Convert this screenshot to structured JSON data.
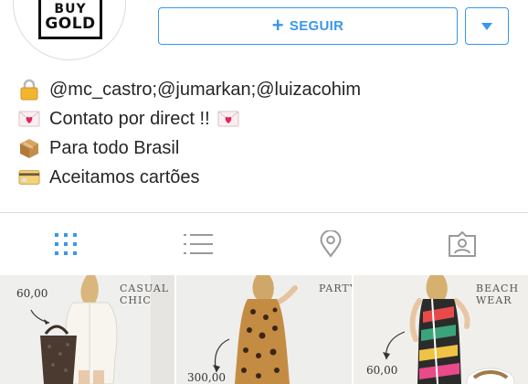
{
  "profile": {
    "logo_line1": "BUY",
    "logo_line2": "GOLD"
  },
  "actions": {
    "follow_label": "SEGUIR",
    "accent_color": "#3897f0"
  },
  "bio": [
    {
      "icon": "lock-icon",
      "text": "@mc_castro;@jumarkan;@luizacohim"
    },
    {
      "icon": "love-letter-icon",
      "text": "Contato por direct !!",
      "trailing_icon": "love-letter-icon"
    },
    {
      "icon": "package-icon",
      "text": "Para todo Brasil"
    },
    {
      "icon": "credit-card-icon",
      "text": "Aceitamos cartões"
    }
  ],
  "tabs": [
    {
      "name": "grid-view",
      "icon": "grid-icon",
      "active": true
    },
    {
      "name": "list-view",
      "icon": "list-icon",
      "active": false
    },
    {
      "name": "map-view",
      "icon": "location-pin-icon",
      "active": false
    },
    {
      "name": "tagged-view",
      "icon": "tagged-person-icon",
      "active": false
    }
  ],
  "posts": [
    {
      "caption": "CASUAL CHIC",
      "price": "60,00"
    },
    {
      "caption": "PARTY",
      "price": "300,00"
    },
    {
      "caption": "BEACH WEAR",
      "price": "60,00"
    }
  ]
}
